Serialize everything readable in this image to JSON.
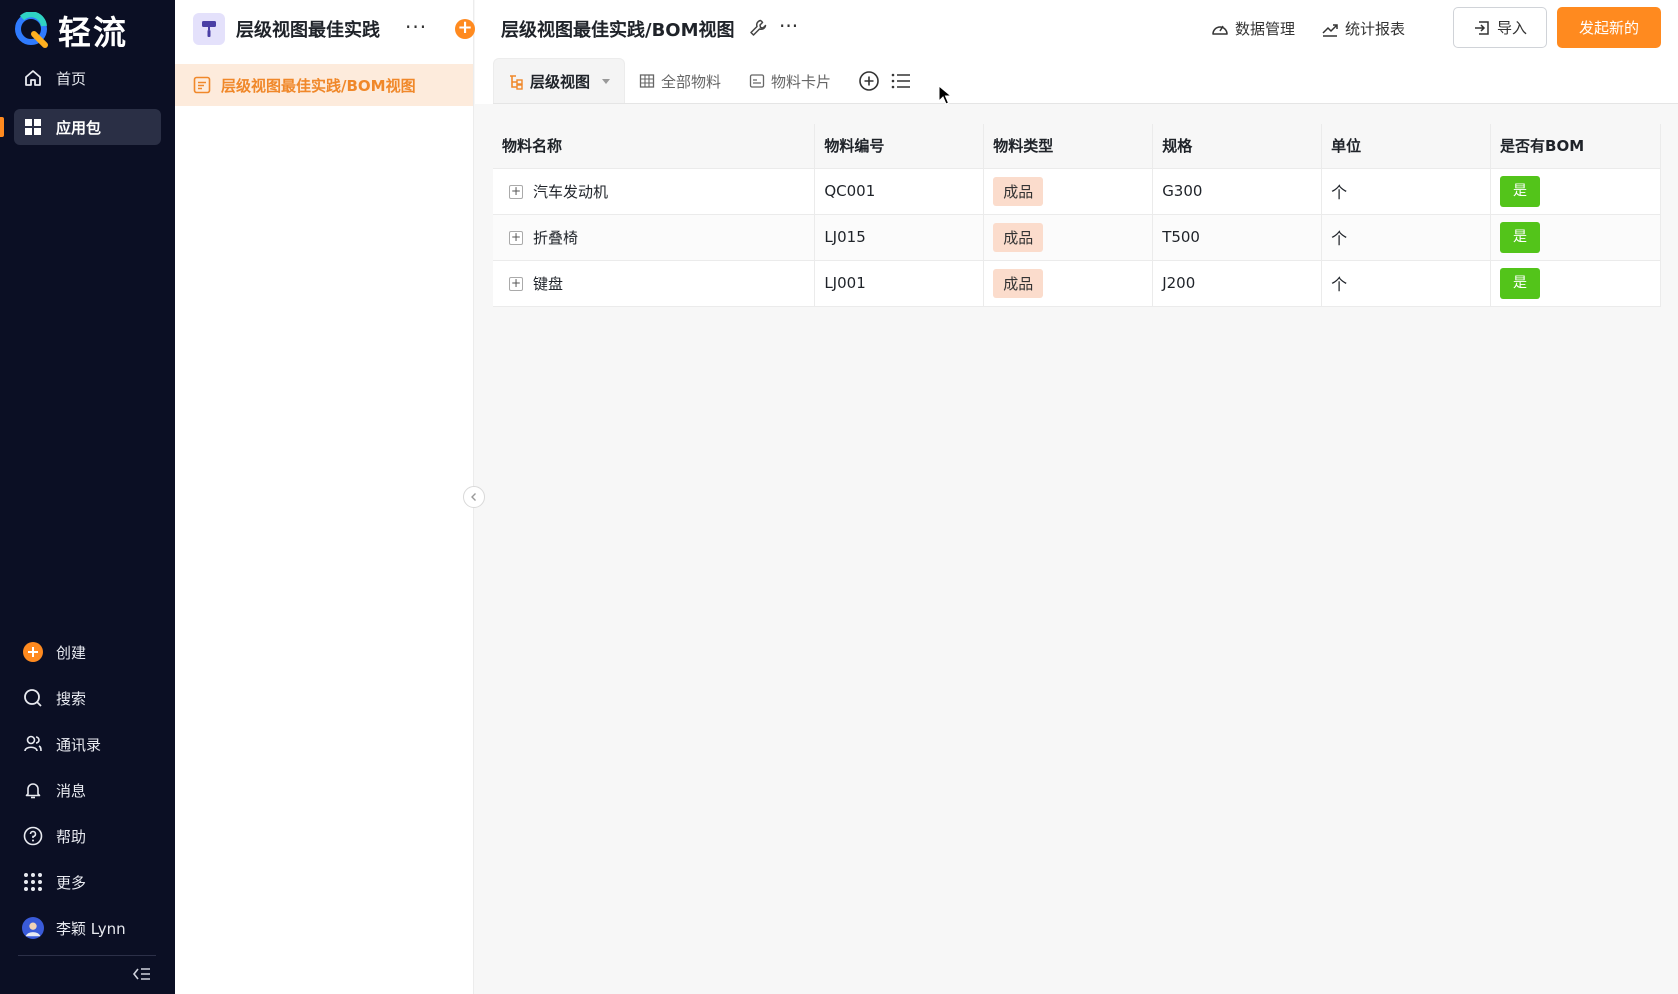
{
  "nav": {
    "logo_text": "轻流",
    "top_items": [
      {
        "label": "首页",
        "icon": "home-icon"
      },
      {
        "label": "应用包",
        "icon": "apps-grid-icon",
        "active": true
      }
    ],
    "bottom_items": [
      {
        "label": "创建",
        "icon": "plus-circle-icon"
      },
      {
        "label": "搜索",
        "icon": "search-icon"
      },
      {
        "label": "通讯录",
        "icon": "contacts-icon"
      },
      {
        "label": "消息",
        "icon": "bell-icon"
      },
      {
        "label": "帮助",
        "icon": "help-icon"
      },
      {
        "label": "更多",
        "icon": "dots-grid-icon"
      },
      {
        "label": "李颖 Lynn",
        "icon": "avatar"
      }
    ],
    "accent": "#ff8a1f"
  },
  "tree": {
    "app_title": "层级视图最佳实践",
    "more": "···",
    "add": "+",
    "items": [
      {
        "label": "层级视图最佳实践/BOM视图",
        "active": true
      }
    ]
  },
  "header": {
    "title": "层级视图最佳实践/BOM视图",
    "more": "···",
    "data_manage": "数据管理",
    "stats_report": "统计报表",
    "import_label": "导入",
    "new_label": "发起新的",
    "tabs": [
      {
        "label": "层级视图",
        "icon": "hierarchy-icon",
        "active": true
      },
      {
        "label": "全部物料",
        "icon": "table-icon"
      },
      {
        "label": "物料卡片",
        "icon": "card-icon"
      }
    ]
  },
  "table": {
    "columns": [
      "物料名称",
      "物料编号",
      "物料类型",
      "规格",
      "单位",
      "是否有BOM"
    ],
    "rows": [
      {
        "name": "汽车发动机",
        "code": "QC001",
        "type": "成品",
        "spec": "G300",
        "unit": "个",
        "has_bom": "是"
      },
      {
        "name": "折叠椅",
        "code": "LJ015",
        "type": "成品",
        "spec": "T500",
        "unit": "个",
        "has_bom": "是"
      },
      {
        "name": "键盘",
        "code": "LJ001",
        "type": "成品",
        "spec": "J200",
        "unit": "个",
        "has_bom": "是"
      }
    ],
    "expand_glyph": "+"
  },
  "colors": {
    "sidebar_bg": "#0b0f24",
    "accent_orange": "#ff8a1f",
    "tag_type_bg": "#fbdccc",
    "tag_yes_bg": "#53c41a"
  }
}
